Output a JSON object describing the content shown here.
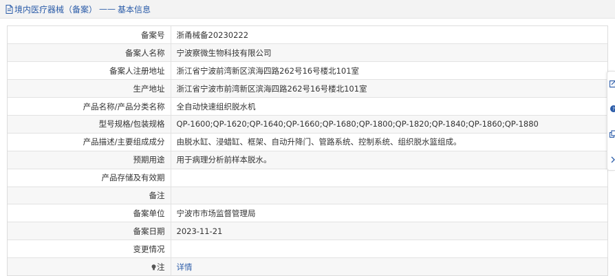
{
  "header": {
    "title": "境内医疗器械（备案）",
    "separator": "——",
    "subtitle": "基本信息"
  },
  "rows": [
    {
      "label": "备案号",
      "value": "浙甬械备20230222"
    },
    {
      "label": "备案人名称",
      "value": "宁波察微生物科技有限公司"
    },
    {
      "label": "备案人注册地址",
      "value": "浙江省宁波前湾新区滨海四路262号16号楼北101室"
    },
    {
      "label": "生产地址",
      "value": "浙江省宁波市前湾新区滨海四路262号16号楼北101室"
    },
    {
      "label": "产品名称/产品分类名称",
      "value": "全自动快速组织脱水机"
    },
    {
      "label": "型号规格/包装规格",
      "value": "QP-1600;QP-1620;QP-1640;QP-1660;QP-1680;QP-1800;QP-1820;QP-1840;QP-1860;QP-1880"
    },
    {
      "label": "产品描述/主要组成成分",
      "value": "由脱水缸、浸蜡缸、框架、自动升降门、管路系统、控制系统、组织脱水篮组成。"
    },
    {
      "label": "预期用途",
      "value": "用于病理分析前样本脱水。"
    },
    {
      "label": "产品存储及有效期",
      "value": ""
    },
    {
      "label": "备注",
      "value": ""
    },
    {
      "label": "备案单位",
      "value": "宁波市市场监督管理局"
    },
    {
      "label": "备案日期",
      "value": "2023-11-21"
    },
    {
      "label": "变更情况",
      "value": ""
    },
    {
      "label": "注",
      "value": "详情"
    }
  ],
  "icons": {
    "header": "document-icon",
    "note": "lightbulb-icon",
    "toolbar": [
      "edit-icon",
      "help-icon",
      "copy-icon",
      "chevron-right-icon"
    ]
  },
  "colors": {
    "link": "#2a5ba8",
    "header_bg": "#f3f3f3",
    "row_alt": "#f7f7f7",
    "border": "#e2e2e2"
  }
}
